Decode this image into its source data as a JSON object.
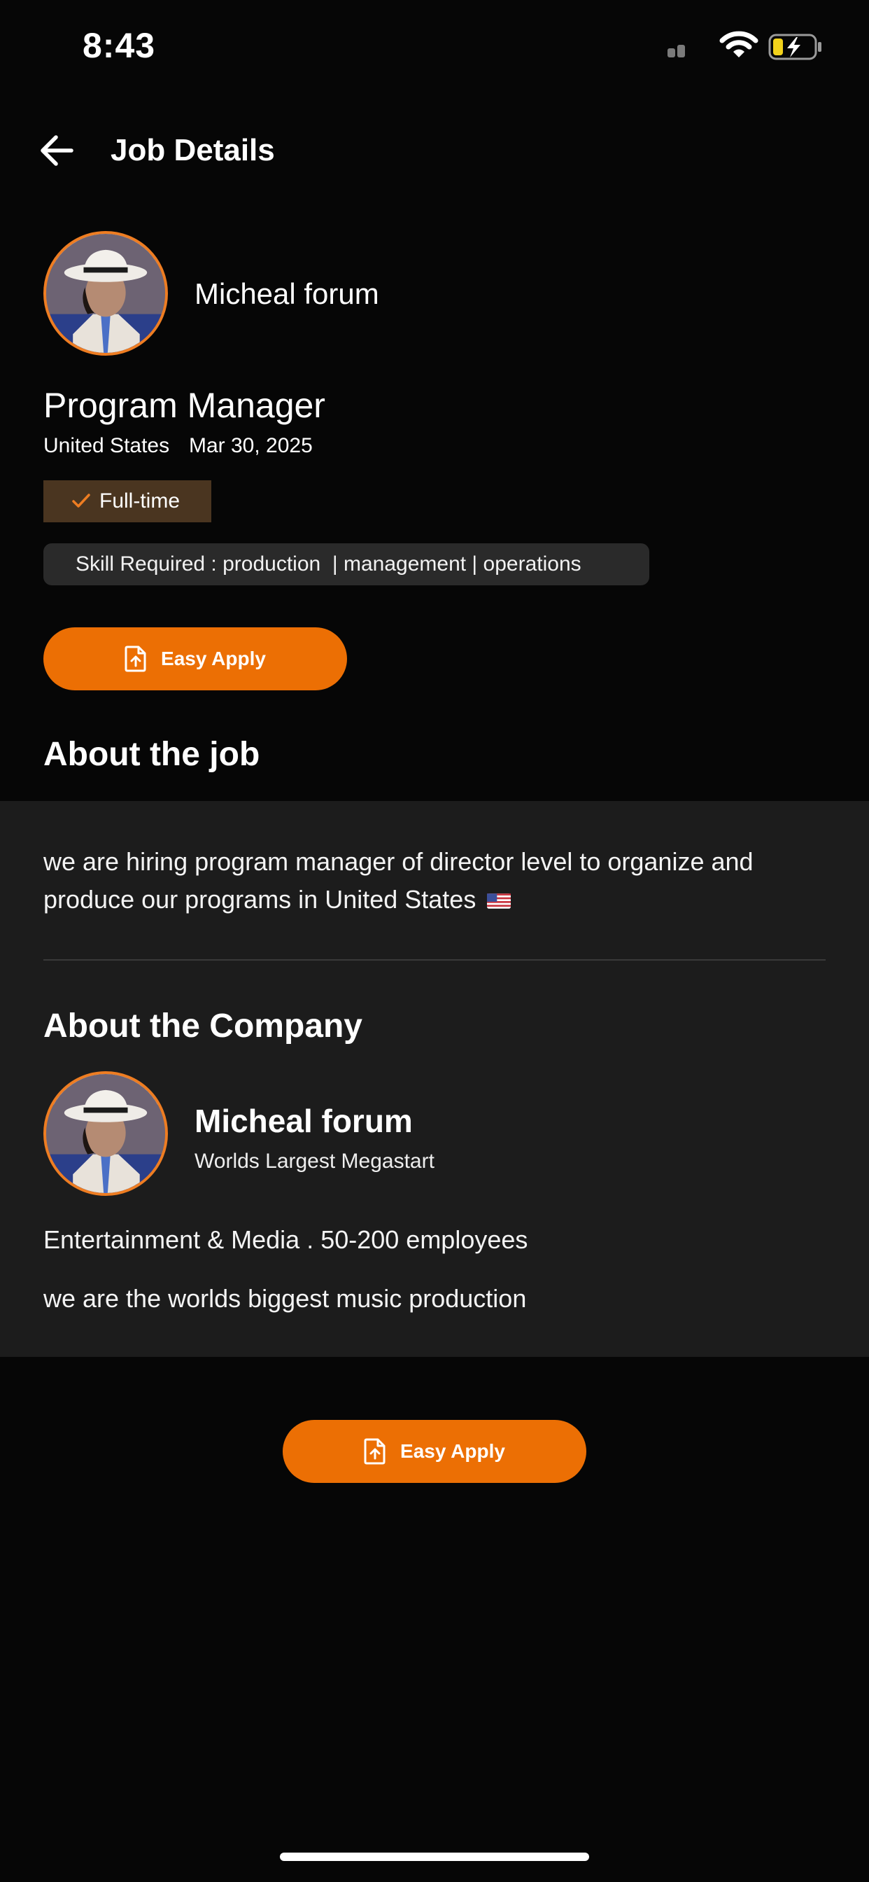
{
  "status_bar": {
    "time": "8:43"
  },
  "header": {
    "title": "Job Details",
    "back_icon": "arrow-left-icon"
  },
  "job": {
    "company_name": "Micheal forum",
    "title": "Program Manager",
    "location": "United States",
    "posted_date": "Mar 30, 2025",
    "employment_type": "Full-time",
    "skills_text": "Skill Required : production  | management | operations",
    "apply_label": "Easy Apply"
  },
  "about_job": {
    "heading": "About the job",
    "description": "we are hiring program manager of director level to organize and produce our programs in United States"
  },
  "about_company": {
    "heading": "About the Company",
    "name": "Micheal forum",
    "tagline": "Worlds Largest Megastart",
    "meta": "Entertainment & Media . 50-200 employees",
    "about": "we are the worlds biggest music production"
  },
  "footer": {
    "apply_label": "Easy Apply"
  },
  "colors": {
    "accent": "#ec6f04",
    "background": "#060606",
    "panel": "#1c1c1c",
    "chip_bg": "#4a3520"
  }
}
